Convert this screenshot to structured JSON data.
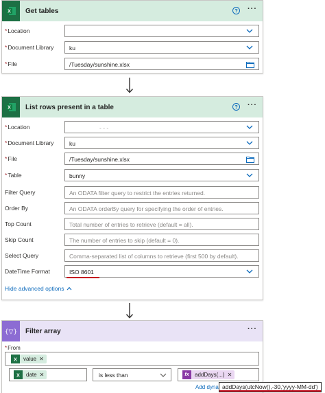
{
  "get_tables": {
    "title": "Get tables",
    "help": "?",
    "more": "···",
    "fields": {
      "location": {
        "label": "Location",
        "value": ""
      },
      "library": {
        "label": "Document Library",
        "value": "ku"
      },
      "file": {
        "label": "File",
        "value": "/Tuesday/sunshine.xlsx"
      }
    },
    "required_mark": "*"
  },
  "list_rows": {
    "title": "List rows present in a table",
    "help": "?",
    "more": "···",
    "required_mark": "*",
    "fields": {
      "location": {
        "label": "Location",
        "value": "- - -"
      },
      "library": {
        "label": "Document Library",
        "value": "ku"
      },
      "file": {
        "label": "File",
        "value": "/Tuesday/sunshine.xlsx"
      },
      "table": {
        "label": "Table",
        "value": "bunny"
      },
      "filter_query": {
        "label": "Filter Query",
        "placeholder": "An ODATA filter query to restrict the entries returned."
      },
      "order_by": {
        "label": "Order By",
        "placeholder": "An ODATA orderBy query for specifying the order of entries."
      },
      "top_count": {
        "label": "Top Count",
        "placeholder": "Total number of entries to retrieve (default = all)."
      },
      "skip_count": {
        "label": "Skip Count",
        "placeholder": "The number of entries to skip (default = 0)."
      },
      "select_query": {
        "label": "Select Query",
        "placeholder": "Comma-separated list of columns to retrieve (first 500 by default)."
      },
      "datetime_format": {
        "label": "DateTime Format",
        "value": "ISO 8601"
      }
    },
    "hide_advanced": "Hide advanced options"
  },
  "filter_array": {
    "title": "Filter array",
    "more": "···",
    "from_label": "From",
    "required_mark": "*",
    "from_token": "value",
    "left_token": "date",
    "operator": "is less than",
    "right_token": "addDays(...)",
    "add_dynamic": "Add dynar",
    "expression_tooltip": "addDays(utcNow(),-30,'yyyy-MM-dd')"
  },
  "colors": {
    "excel_green": "#1d7044",
    "excel_header": "#d5ecdf",
    "filter_purple": "#8c6cd3",
    "filter_header": "#e9e3f6",
    "link_blue": "#0f6cbd",
    "annotation_red": "#c50f1f"
  },
  "icons": [
    "excel-icon",
    "help-icon",
    "more-icon",
    "chevron-down-icon",
    "folder-icon",
    "arrow-down-icon",
    "chevron-up-icon",
    "filter-icon",
    "close-icon",
    "fx-icon"
  ]
}
